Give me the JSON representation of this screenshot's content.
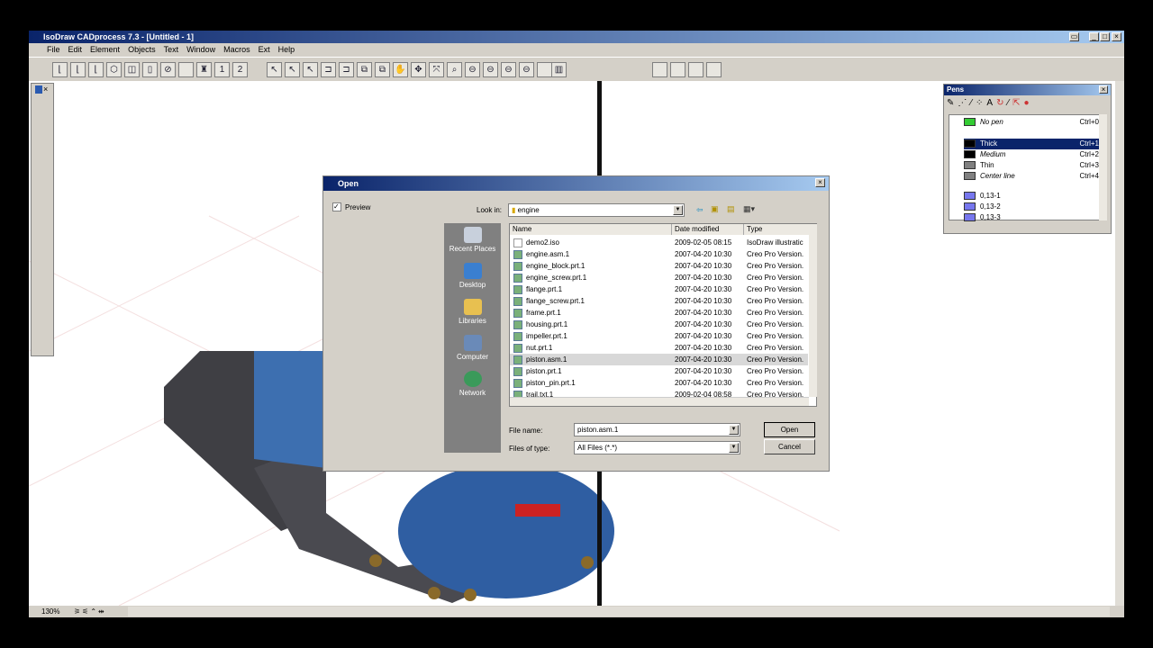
{
  "app": {
    "title": "IsoDraw CADprocess 7.3 - [Untitled - 1]",
    "menu": [
      "File",
      "Edit",
      "Element",
      "Objects",
      "Text",
      "Window",
      "Macros",
      "Ext",
      "Help"
    ],
    "zoom": "130%",
    "toolbar_numbers": [
      "1",
      "2"
    ]
  },
  "dialog": {
    "title": "Open",
    "preview_label": "Preview",
    "look_in_label": "Look in:",
    "look_in_value": "engine",
    "places": [
      "Recent Places",
      "Desktop",
      "Libraries",
      "Computer",
      "Network"
    ],
    "columns": [
      "Name",
      "Date modified",
      "Type"
    ],
    "files": [
      {
        "name": "demo2.iso",
        "date": "2009-02-05 08:15",
        "type": "IsoDraw illustratic"
      },
      {
        "name": "engine.asm.1",
        "date": "2007-04-20 10:30",
        "type": "Creo Pro Version."
      },
      {
        "name": "engine_block.prt.1",
        "date": "2007-04-20 10:30",
        "type": "Creo Pro Version."
      },
      {
        "name": "engine_screw.prt.1",
        "date": "2007-04-20 10:30",
        "type": "Creo Pro Version."
      },
      {
        "name": "flange.prt.1",
        "date": "2007-04-20 10:30",
        "type": "Creo Pro Version."
      },
      {
        "name": "flange_screw.prt.1",
        "date": "2007-04-20 10:30",
        "type": "Creo Pro Version."
      },
      {
        "name": "frame.prt.1",
        "date": "2007-04-20 10:30",
        "type": "Creo Pro Version."
      },
      {
        "name": "housing.prt.1",
        "date": "2007-04-20 10:30",
        "type": "Creo Pro Version."
      },
      {
        "name": "impeller.prt.1",
        "date": "2007-04-20 10:30",
        "type": "Creo Pro Version."
      },
      {
        "name": "nut.prt.1",
        "date": "2007-04-20 10:30",
        "type": "Creo Pro Version."
      },
      {
        "name": "piston.asm.1",
        "date": "2007-04-20 10:30",
        "type": "Creo Pro Version."
      },
      {
        "name": "piston.prt.1",
        "date": "2007-04-20 10:30",
        "type": "Creo Pro Version."
      },
      {
        "name": "piston_pin.prt.1",
        "date": "2007-04-20 10:30",
        "type": "Creo Pro Version."
      },
      {
        "name": "trail.txt.1",
        "date": "2009-02-04 08:58",
        "type": "Creo Pro Version."
      }
    ],
    "selected_index": 10,
    "file_name_label": "File name:",
    "file_name_value": "piston.asm.1",
    "file_type_label": "Files of type:",
    "file_type_value": "All Files (*.*)",
    "open_label": "Open",
    "cancel_label": "Cancel"
  },
  "pens": {
    "title": "Pens",
    "items": [
      {
        "name": "No pen",
        "shortcut": "Ctrl+0",
        "color": "#33cc33"
      },
      {
        "name": "Thick",
        "shortcut": "Ctrl+1",
        "color": "#000000"
      },
      {
        "name": "Medium",
        "shortcut": "Ctrl+2",
        "color": "#000000"
      },
      {
        "name": "Thin",
        "shortcut": "Ctrl+3",
        "color": "#808080"
      },
      {
        "name": "Center line",
        "shortcut": "Ctrl+4",
        "color": "#808080"
      },
      {
        "name": "0,13-1",
        "shortcut": "",
        "color": "#7777ee"
      },
      {
        "name": "0,13-2",
        "shortcut": "",
        "color": "#7777ee"
      },
      {
        "name": "0,13-3",
        "shortcut": "",
        "color": "#7777ee"
      }
    ]
  }
}
